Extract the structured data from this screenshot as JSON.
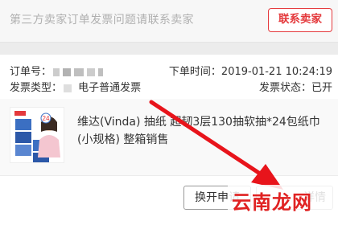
{
  "banner": {
    "message": "第三方卖家订单发票问题请联系卖家",
    "contact_button": "联系卖家"
  },
  "order": {
    "number_label": "订单号：",
    "time_label": "下单时间：",
    "time_value": "2019-01-21 10:24:19",
    "invoice_type_label": "发票类型：",
    "invoice_type_value": "电子普通发票",
    "invoice_status_label": "发票状态：",
    "invoice_status_value": "已开"
  },
  "product": {
    "title": "维达(Vinda) 抽纸 超韧3层130抽软抽*24包纸巾(小规格) 整箱销售",
    "thumb_badge": "24"
  },
  "actions": {
    "reissue_label": "换开申请",
    "detail_label": "详情"
  },
  "watermark": {
    "text": "云南龙网"
  },
  "colors": {
    "accent_red": "#e4393c",
    "arrow_red": "#e8141b"
  },
  "icons": [
    "red-arrow-annotation",
    "product-thumbnail"
  ]
}
